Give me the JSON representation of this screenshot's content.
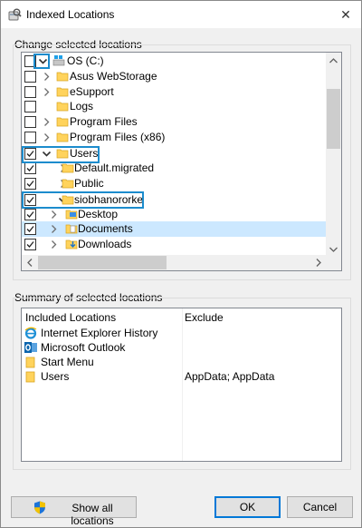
{
  "window": {
    "title": "Indexed Locations",
    "close_glyph": "✕"
  },
  "change_section": {
    "label": "Change selected locations",
    "tree": [
      {
        "label": "OS (C:)",
        "checked": false,
        "expander": "expanded",
        "icon": "drive-icon"
      },
      {
        "label": "Asus WebStorage",
        "checked": false,
        "expander": "collapsed",
        "icon": "folder-icon"
      },
      {
        "label": "eSupport",
        "checked": false,
        "expander": "collapsed",
        "icon": "folder-icon"
      },
      {
        "label": "Logs",
        "checked": false,
        "expander": "none",
        "icon": "folder-icon"
      },
      {
        "label": "Program Files",
        "checked": false,
        "expander": "collapsed",
        "icon": "folder-icon"
      },
      {
        "label": "Program Files (x86)",
        "checked": false,
        "expander": "collapsed",
        "icon": "folder-icon"
      },
      {
        "label": "Users",
        "checked": true,
        "expander": "expanded",
        "icon": "folder-icon"
      },
      {
        "label": "Default.migrated",
        "checked": true,
        "expander": "collapsed",
        "icon": "folder-icon"
      },
      {
        "label": "Public",
        "checked": true,
        "expander": "collapsed",
        "icon": "folder-icon"
      },
      {
        "label": "siobhanororke",
        "checked": true,
        "expander": "expanded",
        "icon": "folder-icon"
      },
      {
        "label": "Desktop",
        "checked": true,
        "expander": "collapsed",
        "icon": "desktop-folder-icon"
      },
      {
        "label": "Documents",
        "checked": true,
        "expander": "collapsed",
        "icon": "documents-folder-icon",
        "selected": true
      },
      {
        "label": "Downloads",
        "checked": true,
        "expander": "collapsed",
        "icon": "downloads-folder-icon"
      }
    ]
  },
  "summary_section": {
    "label": "Summary of selected locations",
    "columns": [
      "Included Locations",
      "Exclude"
    ],
    "rows": [
      {
        "label": "Internet Explorer History",
        "exclude": "",
        "icon": "internet-explorer-icon"
      },
      {
        "label": "Microsoft Outlook",
        "exclude": "",
        "icon": "outlook-icon"
      },
      {
        "label": "Start Menu",
        "exclude": "",
        "icon": "folder-icon"
      },
      {
        "label": "Users",
        "exclude": "AppData; AppData",
        "icon": "folder-icon"
      }
    ]
  },
  "buttons": {
    "show_all": "Show all locations",
    "ok": "OK",
    "cancel": "Cancel"
  },
  "colors": {
    "highlight_border": "#1c8ccd",
    "selection_bg": "#cce8ff",
    "folder_yellow": "#ffd35c"
  }
}
